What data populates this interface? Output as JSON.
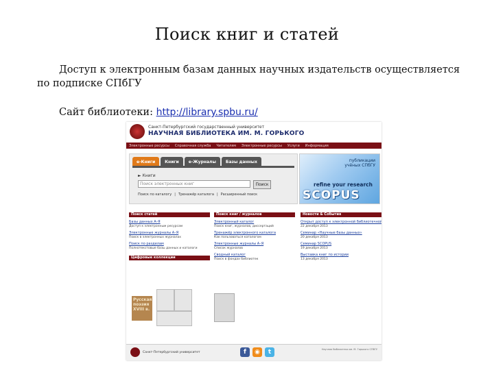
{
  "slide": {
    "title": "Поиск книг и статей",
    "line1": "Доступ к электронным базам данных научных издательств осуществляется",
    "line2": "по подписке СПбГУ",
    "site_prefix": "Сайт библиотеки: ",
    "site_url": "http://library.spbu.ru/"
  },
  "site": {
    "university": "Санкт-Петербургский государственный университет",
    "library": "НАУЧНАЯ БИБЛИОТЕКА ИМ. М. ГОРЬКОГО",
    "nav": [
      "Электронные ресурсы",
      "Справочная служба",
      "Читателям",
      "Электронные ресурсы",
      "Услуги",
      "Информация"
    ],
    "tabs": [
      "е-Книги",
      "Книги",
      "е-Журналы",
      "Базы данных"
    ],
    "search_label": "► Книги",
    "search_placeholder": "Поиск электронных книг",
    "search_button": "Поиск",
    "search_links": [
      "Поиск по каталогу",
      "Тренажёр каталога",
      "Расширенный поиск"
    ],
    "banner_top": "публикации учёных СПбГУ",
    "banner_refine": "refine your research",
    "banner_scopus": "SCOPUS",
    "col1_header": "Поиск статей",
    "col1_items": [
      {
        "t": "Базы данных А–Я",
        "d": "Доступ к электронным ресурсам"
      },
      {
        "t": "Электронные журналы А–Я",
        "d": "Поиск в электронных журналах"
      },
      {
        "t": "Поиск по разделам",
        "d": "Полнотекстовые базы данных и каталоги"
      }
    ],
    "col1_header2": "Цифровые коллекции",
    "col2_header": "Поиск книг / журналов",
    "col2_items": [
      {
        "t": "Электронный каталог",
        "d": "Поиск книг, журналов, диссертаций"
      },
      {
        "t": "Тренажёр электронного каталога",
        "d": "Как пользоваться каталогом"
      },
      {
        "t": "Электронные журналы А–Я",
        "d": "Список журналов"
      },
      {
        "t": "Сводный каталог",
        "d": "Поиск в фондах библиотек"
      }
    ],
    "col3_header": "Новости & События",
    "col3_items": [
      {
        "t": "Открыт доступ к электронной библиотечной системе",
        "d": "22 декабря 2013"
      },
      {
        "t": "Семинар «Научные базы данных»",
        "d": "20 декабря 2013"
      },
      {
        "t": "Семинар SCOPUS",
        "d": "19 декабря 2013"
      },
      {
        "t": "Выставка книг по истории",
        "d": "13 декабря 2013"
      }
    ],
    "russian_poetry": "Русская поэзия XVIII в.",
    "footer_text": "Санкт-Петербургский университет",
    "footer_right": "Научная библиотека им. М. Горького СПбГУ"
  }
}
